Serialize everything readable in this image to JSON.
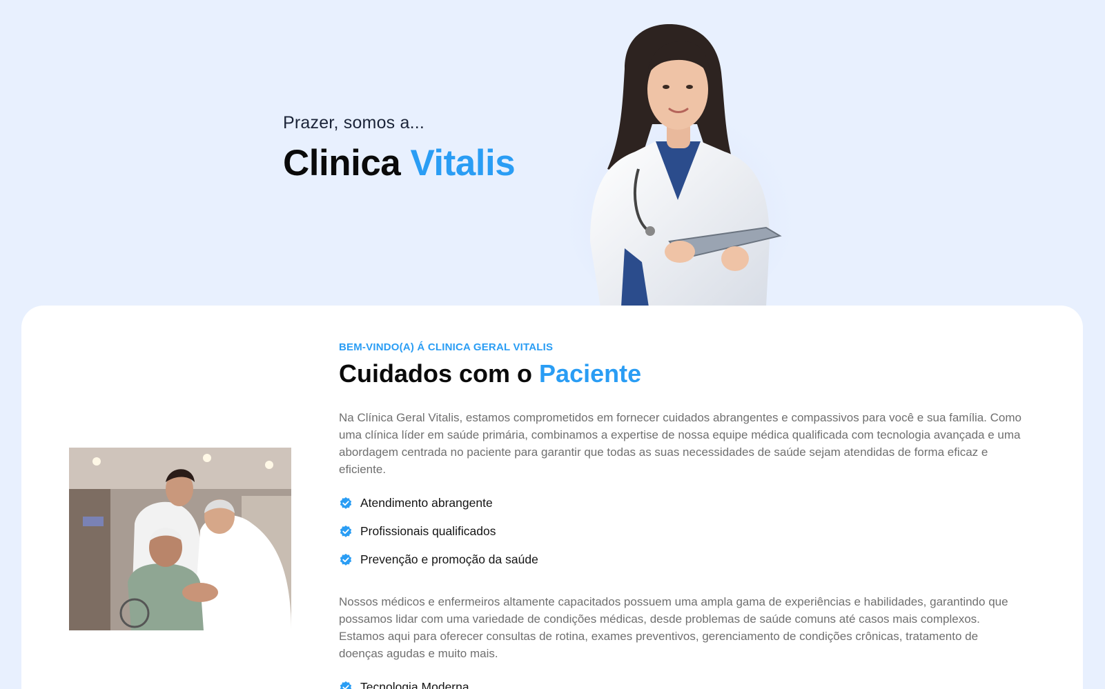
{
  "hero": {
    "intro": "Prazer, somos a...",
    "title_main": "Clinica",
    "title_accent": "Vitalis"
  },
  "about": {
    "eyebrow": "BEM-VINDO(A) Á CLINICA GERAL VITALIS",
    "title_main": "Cuidados com o",
    "title_accent": "Paciente",
    "paragraph_1": "Na Clínica Geral Vitalis, estamos comprometidos em fornecer cuidados abrangentes e compassivos para você e sua família. Como uma clínica líder em saúde primária, combinamos a expertise de nossa equipe médica qualificada com tecnologia avançada e uma abordagem centrada no paciente para garantir que todas as suas necessidades de saúde sejam atendidas de forma eficaz e eficiente.",
    "features_1": [
      {
        "label": "Atendimento abrangente",
        "icon": "verified-check-icon"
      },
      {
        "label": "Profissionais qualificados",
        "icon": "verified-check-icon"
      },
      {
        "label": "Prevenção e promoção da saúde",
        "icon": "verified-check-icon"
      }
    ],
    "paragraph_2": "Nossos médicos e enfermeiros altamente capacitados possuem uma ampla gama de experiências e habilidades, garantindo que possamos lidar com uma variedade de condições médicas, desde problemas de saúde comuns até casos mais complexos. Estamos aqui para oferecer consultas de rotina, exames preventivos, gerenciamento de condições crônicas, tratamento de doenças agudas e muito mais.",
    "features_2": [
      {
        "label": "Tecnologia Moderna",
        "icon": "verified-check-icon"
      }
    ]
  },
  "colors": {
    "accent": "#2a9df4",
    "hero_background": "#e8f0fe",
    "card_background": "#ffffff",
    "body_text": "#6f6f6f"
  }
}
